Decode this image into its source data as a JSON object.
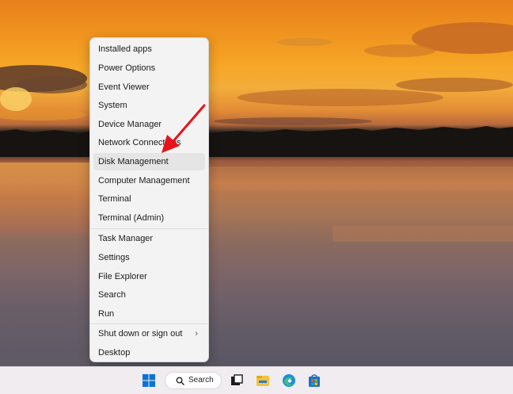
{
  "menu": {
    "items": [
      {
        "label": "Installed apps"
      },
      {
        "label": "Power Options"
      },
      {
        "label": "Event Viewer"
      },
      {
        "label": "System"
      },
      {
        "label": "Device Manager"
      },
      {
        "label": "Network Connections"
      },
      {
        "label": "Disk Management"
      },
      {
        "label": "Computer Management"
      },
      {
        "label": "Terminal"
      },
      {
        "label": "Terminal (Admin)"
      },
      {
        "label": "Task Manager"
      },
      {
        "label": "Settings"
      },
      {
        "label": "File Explorer"
      },
      {
        "label": "Search"
      },
      {
        "label": "Run"
      },
      {
        "label": "Shut down or sign out"
      },
      {
        "label": "Desktop"
      }
    ],
    "highlighted": "Disk Management"
  },
  "taskbar": {
    "search_label": "Search",
    "icons": [
      "windows-start-icon",
      "search-icon",
      "task-view-icon",
      "file-explorer-icon",
      "edge-icon",
      "microsoft-store-icon"
    ]
  },
  "colors": {
    "annotation_arrow": "#e8141b",
    "menu_background": "#f3f3f3",
    "highlight": "#e5e5e5"
  }
}
